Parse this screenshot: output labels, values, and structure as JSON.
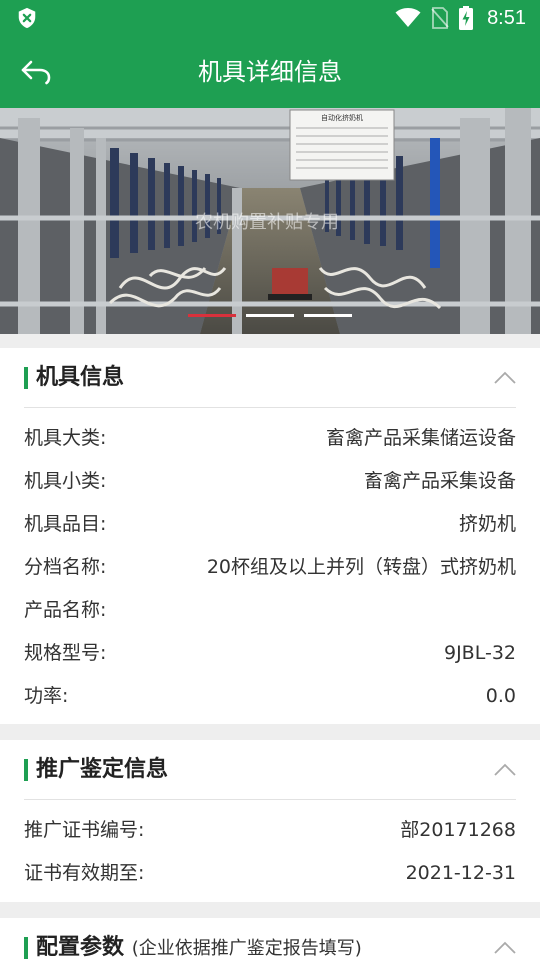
{
  "status_bar": {
    "time": "8:51"
  },
  "app_bar": {
    "title": "机具详细信息"
  },
  "banner": {
    "watermark": "农机购置补贴专用",
    "sign_title": "自动化挤奶机",
    "slides": 3,
    "active_slide": 1
  },
  "machine_info": {
    "title": "机具信息",
    "rows": [
      {
        "label": "机具大类:",
        "value": "畜禽产品采集储运设备"
      },
      {
        "label": "机具小类:",
        "value": "畜禽产品采集设备"
      },
      {
        "label": "机具品目:",
        "value": "挤奶机"
      },
      {
        "label": "分档名称:",
        "value": "20杯组及以上并列（转盘）式挤奶机"
      },
      {
        "label": "产品名称:",
        "value": ""
      },
      {
        "label": "规格型号:",
        "value": "9JBL-32"
      },
      {
        "label": "功率:",
        "value": "0.0"
      }
    ]
  },
  "promotion_info": {
    "title": "推广鉴定信息",
    "rows": [
      {
        "label": "推广证书编号:",
        "value": "部20171268"
      },
      {
        "label": "证书有效期至:",
        "value": "2021-12-31"
      }
    ]
  },
  "config_params": {
    "title": "配置参数",
    "note": "(企业依据推广鉴定报告填写)"
  },
  "colors": {
    "primary": "#1e9f52",
    "indicator_active": "#d9313c"
  },
  "icons": [
    "shield-x-icon",
    "wifi-icon",
    "no-sim-icon",
    "battery-charging-icon",
    "back-arrow-icon",
    "chevron-up-icon"
  ]
}
